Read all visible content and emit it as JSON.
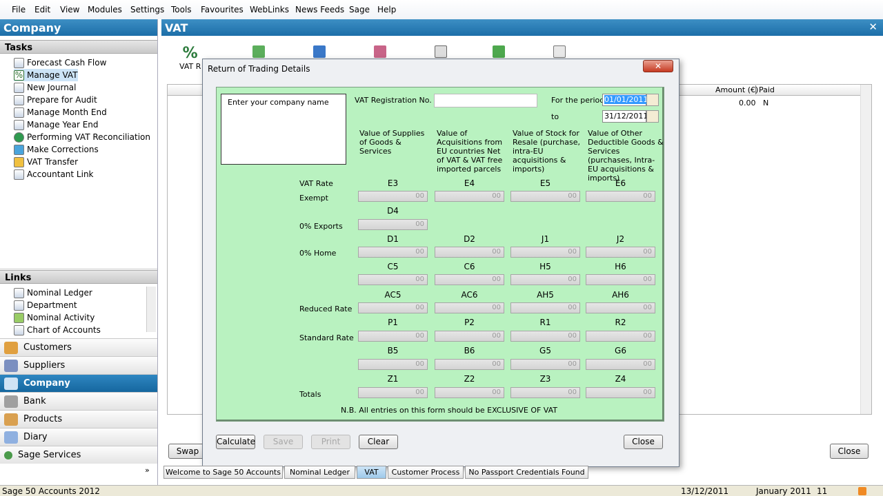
{
  "menu": [
    "File",
    "Edit",
    "View",
    "Modules",
    "Settings",
    "Tools",
    "Favourites",
    "WebLinks",
    "News Feeds",
    "Sage",
    "Help"
  ],
  "left_title": "Company",
  "tasks_header": "Tasks",
  "tasks": [
    "Forecast Cash Flow",
    "Manage VAT",
    "New Journal",
    "Prepare for Audit",
    "Manage Month End",
    "Manage Year End",
    "Performing VAT Reconciliation",
    "Make Corrections",
    "VAT Transfer",
    "Accountant Link"
  ],
  "links_header": "Links",
  "links": [
    "Nominal Ledger",
    "Department",
    "Nominal Activity",
    "Chart of Accounts"
  ],
  "modules": [
    "Customers",
    "Suppliers",
    "Company",
    "Bank",
    "Products",
    "Diary",
    "Sage Services"
  ],
  "vat_title": "VAT",
  "vat_toolbar_first": "VAT R",
  "grid_header": {
    "amount": "Amount (€)",
    "paid": "Paid"
  },
  "grid_row": {
    "amount": "0.00",
    "paid": "N"
  },
  "pane_buttons": {
    "swap": "Swap",
    "close": "Close"
  },
  "dialog": {
    "title": "Return of Trading Details",
    "company_placeholder": "Enter your company name",
    "vat_reg_label": "VAT Registration No.",
    "period_label": "For the period",
    "to_label": "to",
    "date_from": "01/01/2011",
    "date_to": "31/12/2011",
    "col_headers": [
      "Value of Supplies of Goods & Services",
      "Value of Acquisitions from EU countries Net of VAT & VAT free imported parcels",
      "Value of Stock for Resale (purchase, intra-EU acquisitions & imports)",
      "Value of Other Deductible Goods & Services (purchases, Intra-EU acquisitions & imports)"
    ],
    "vat_rate_label": "VAT Rate",
    "row_labels": {
      "exempt": "Exempt",
      "exports": "0% Exports",
      "home": "0% Home",
      "reduced": "Reduced Rate",
      "standard": "Standard Rate",
      "totals": "Totals"
    },
    "codes": {
      "r1": [
        "E3",
        "E4",
        "E5",
        "E6"
      ],
      "r2": [
        "D4"
      ],
      "r3": [
        "D1",
        "D2",
        "J1",
        "J2"
      ],
      "r4": [
        "C5",
        "C6",
        "H5",
        "H6"
      ],
      "r5": [
        "AC5",
        "AC6",
        "AH5",
        "AH6"
      ],
      "r6": [
        "P1",
        "P2",
        "R1",
        "R2"
      ],
      "r7": [
        "B5",
        "B6",
        "G5",
        "G6"
      ],
      "r8": [
        "Z1",
        "Z2",
        "Z3",
        "Z4"
      ]
    },
    "field_value": "00",
    "note": "N.B. All entries on this form should be EXCLUSIVE OF VAT",
    "buttons": {
      "calculate": "Calculate",
      "save": "Save",
      "print": "Print",
      "clear": "Clear",
      "close": "Close"
    }
  },
  "bottom_tabs": [
    "Welcome to Sage 50 Accounts",
    "Nominal Ledger",
    "VAT",
    "Customer Process",
    "No Passport Credentials Found"
  ],
  "status": {
    "app": "Sage 50 Accounts 2012",
    "date": "13/12/2011",
    "period": "January 2011",
    "count": "11"
  }
}
